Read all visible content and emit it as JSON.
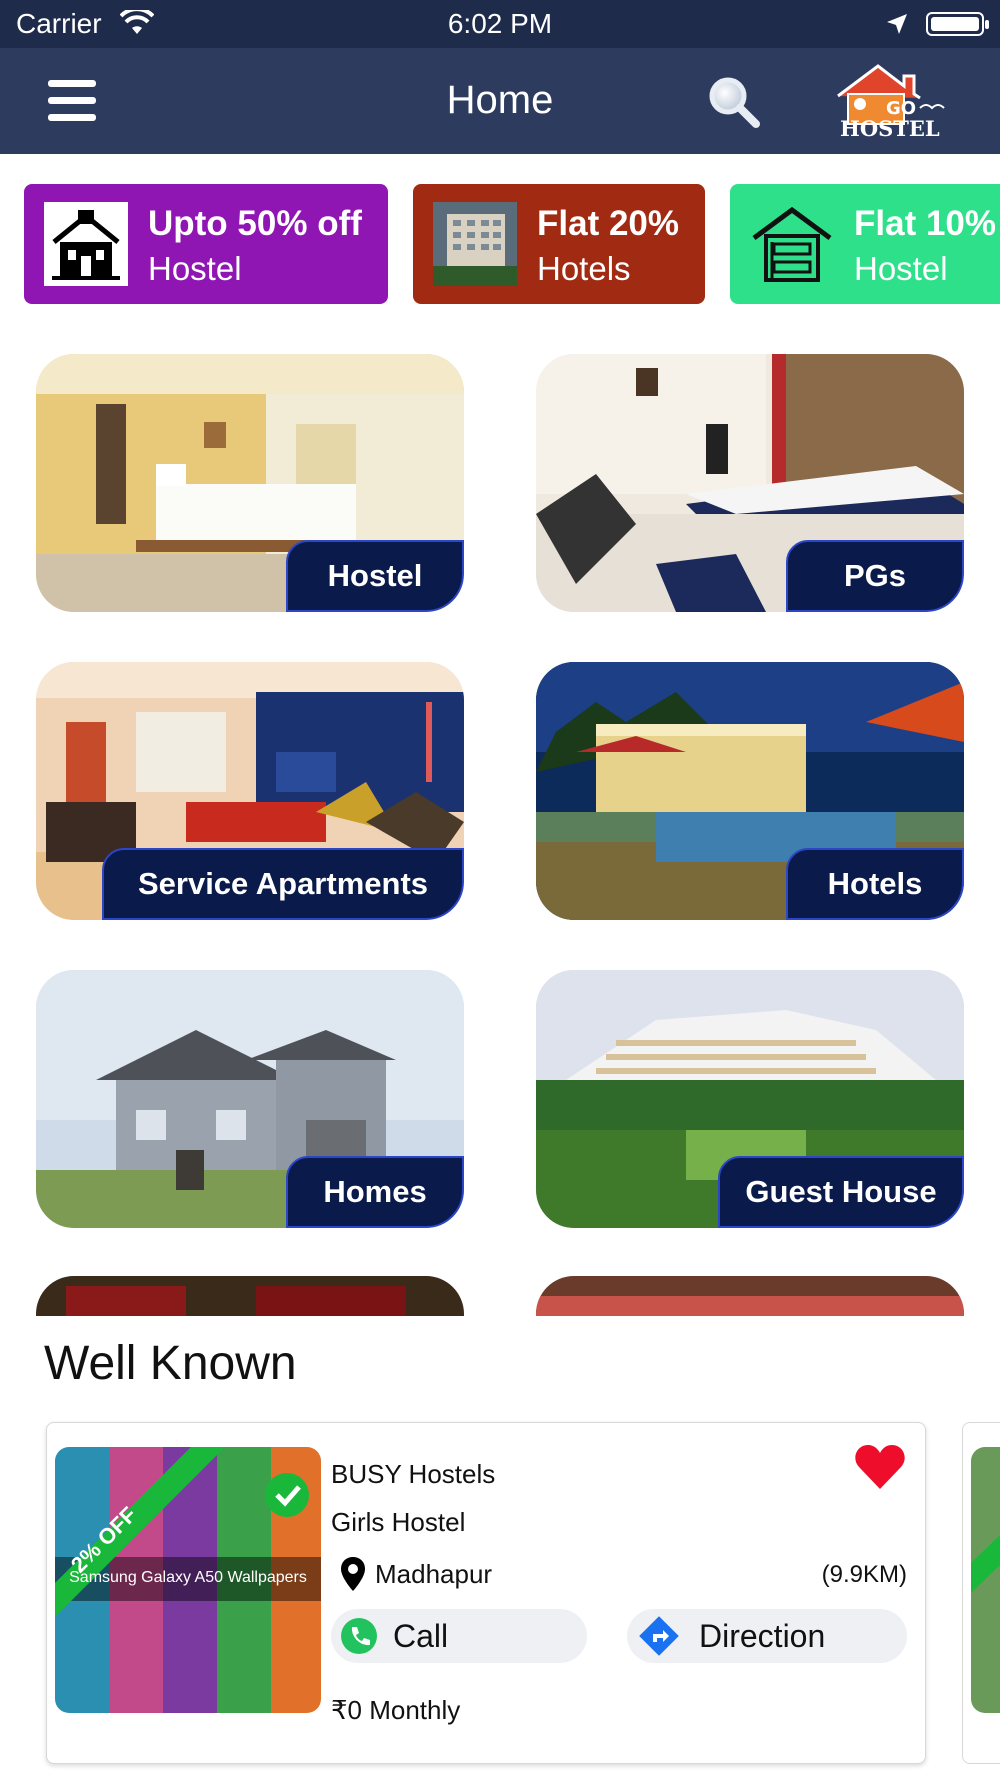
{
  "status_bar": {
    "carrier": "Carrier",
    "time": "6:02 PM"
  },
  "header": {
    "title": "Home",
    "logo_text": "GO HOSTEL"
  },
  "promos": [
    {
      "title": "Upto 50% off",
      "subtitle": "Hostel",
      "color": "#9016b4"
    },
    {
      "title": "Flat 20%",
      "subtitle": "Hotels",
      "color": "#a02a12"
    },
    {
      "title": "Flat 10%",
      "subtitle": "Hostel",
      "color": "#2ee08a"
    }
  ],
  "categories": [
    {
      "label": "Hostel"
    },
    {
      "label": "PGs"
    },
    {
      "label": "Service Apartments"
    },
    {
      "label": "Hotels"
    },
    {
      "label": "Homes"
    },
    {
      "label": "Guest House"
    }
  ],
  "well_known": {
    "title": "Well Known",
    "card": {
      "badge": "2% OFF",
      "thumb_caption": "Samsung Galaxy A50 Wallpapers",
      "name": "BUSY Hostels",
      "type": "Girls Hostel",
      "location": "Madhapur",
      "distance": "(9.9KM)",
      "call_label": "Call",
      "direction_label": "Direction",
      "price": "₹0 Monthly"
    }
  },
  "colors": {
    "status_bar": "#1f2b4a",
    "nav_bar": "#2d3b5f",
    "tile_label": "#0a1a4a"
  }
}
